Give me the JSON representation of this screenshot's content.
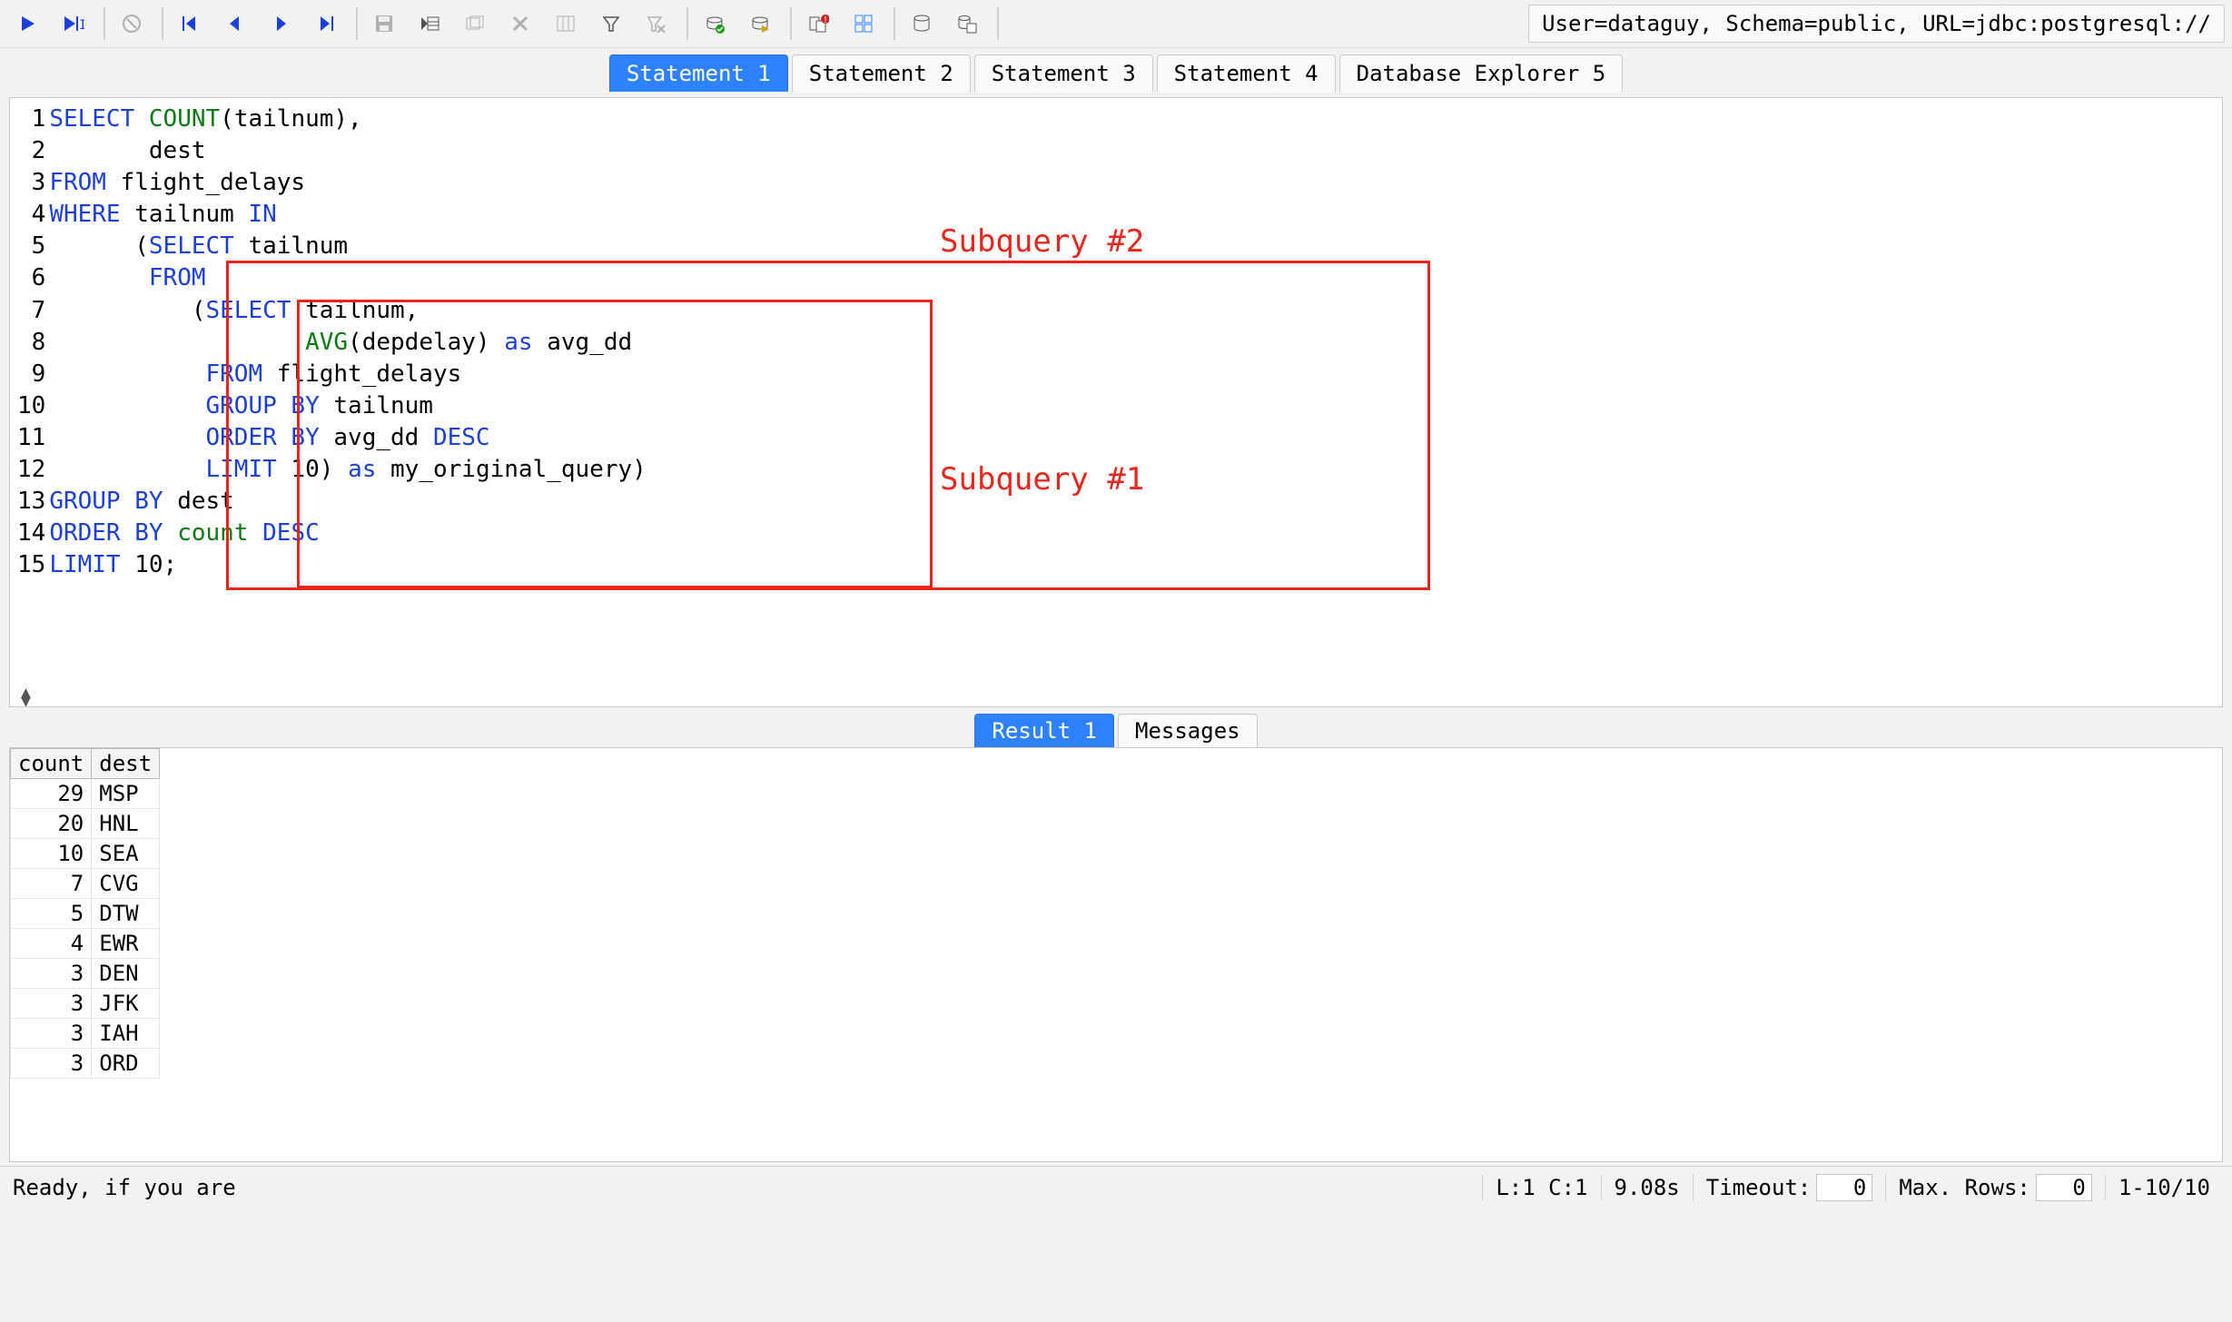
{
  "connection_info": "User=dataguy, Schema=public, URL=jdbc:postgresql://",
  "tabs": [
    {
      "label": "Statement 1",
      "active": true
    },
    {
      "label": "Statement 2",
      "active": false
    },
    {
      "label": "Statement 3",
      "active": false
    },
    {
      "label": "Statement 4",
      "active": false
    },
    {
      "label": "Database Explorer 5",
      "active": false
    }
  ],
  "editor": {
    "line_numbers": [
      "1",
      "2",
      "3",
      "4",
      "5",
      "6",
      "7",
      "8",
      "9",
      "10",
      "11",
      "12",
      "13",
      "14",
      "15"
    ],
    "tokens": [
      [
        [
          "kw",
          "SELECT"
        ],
        [
          "",
          " "
        ],
        [
          "fn",
          "COUNT"
        ],
        [
          "",
          "(tailnum),"
        ]
      ],
      [
        [
          "",
          "       dest"
        ]
      ],
      [
        [
          "kw",
          "FROM"
        ],
        [
          "",
          " flight_delays"
        ]
      ],
      [
        [
          "kw",
          "WHERE"
        ],
        [
          "",
          " tailnum "
        ],
        [
          "kw",
          "IN"
        ]
      ],
      [
        [
          "",
          "      ("
        ],
        [
          "kw",
          "SELECT"
        ],
        [
          "",
          " tailnum"
        ]
      ],
      [
        [
          "",
          "       "
        ],
        [
          "kw",
          "FROM"
        ]
      ],
      [
        [
          "",
          "          ("
        ],
        [
          "kw",
          "SELECT"
        ],
        [
          "",
          " tailnum,"
        ]
      ],
      [
        [
          "",
          "                  "
        ],
        [
          "fn",
          "AVG"
        ],
        [
          "",
          "(depdelay) "
        ],
        [
          "kw",
          "as"
        ],
        [
          "",
          " avg_dd"
        ]
      ],
      [
        [
          "",
          "           "
        ],
        [
          "kw",
          "FROM"
        ],
        [
          "",
          " flight_delays"
        ]
      ],
      [
        [
          "",
          "           "
        ],
        [
          "kw",
          "GROUP BY"
        ],
        [
          "",
          " tailnum"
        ]
      ],
      [
        [
          "",
          "           "
        ],
        [
          "kw",
          "ORDER BY"
        ],
        [
          "",
          " avg_dd "
        ],
        [
          "kw",
          "DESC"
        ]
      ],
      [
        [
          "",
          "           "
        ],
        [
          "kw",
          "LIMIT"
        ],
        [
          "",
          " 10) "
        ],
        [
          "kw",
          "as"
        ],
        [
          "",
          " my_original_query)"
        ]
      ],
      [
        [
          "kw",
          "GROUP BY"
        ],
        [
          "",
          " dest"
        ]
      ],
      [
        [
          "kw",
          "ORDER BY"
        ],
        [
          "",
          " "
        ],
        [
          "id",
          "count"
        ],
        [
          "",
          " "
        ],
        [
          "kw",
          "DESC"
        ]
      ],
      [
        [
          "kw",
          "LIMIT"
        ],
        [
          "",
          " 10;"
        ]
      ]
    ],
    "annotations": {
      "label1": "Subquery #1",
      "label2": "Subquery #2"
    }
  },
  "result_tabs": [
    {
      "label": "Result 1",
      "active": true
    },
    {
      "label": "Messages",
      "active": false
    }
  ],
  "results": {
    "headers": [
      "count",
      "dest"
    ],
    "rows": [
      {
        "count": "29",
        "dest": "MSP"
      },
      {
        "count": "20",
        "dest": "HNL"
      },
      {
        "count": "10",
        "dest": "SEA"
      },
      {
        "count": "7",
        "dest": "CVG"
      },
      {
        "count": "5",
        "dest": "DTW"
      },
      {
        "count": "4",
        "dest": "EWR"
      },
      {
        "count": "3",
        "dest": "DEN"
      },
      {
        "count": "3",
        "dest": "JFK"
      },
      {
        "count": "3",
        "dest": "IAH"
      },
      {
        "count": "3",
        "dest": "ORD"
      }
    ]
  },
  "status": {
    "message": "Ready, if you are",
    "cursor": "L:1 C:1",
    "elapsed": "9.08s",
    "timeout_label": "Timeout:",
    "timeout_value": "0",
    "maxrows_label": "Max. Rows:",
    "maxrows_value": "0",
    "range": "1-10/10"
  }
}
